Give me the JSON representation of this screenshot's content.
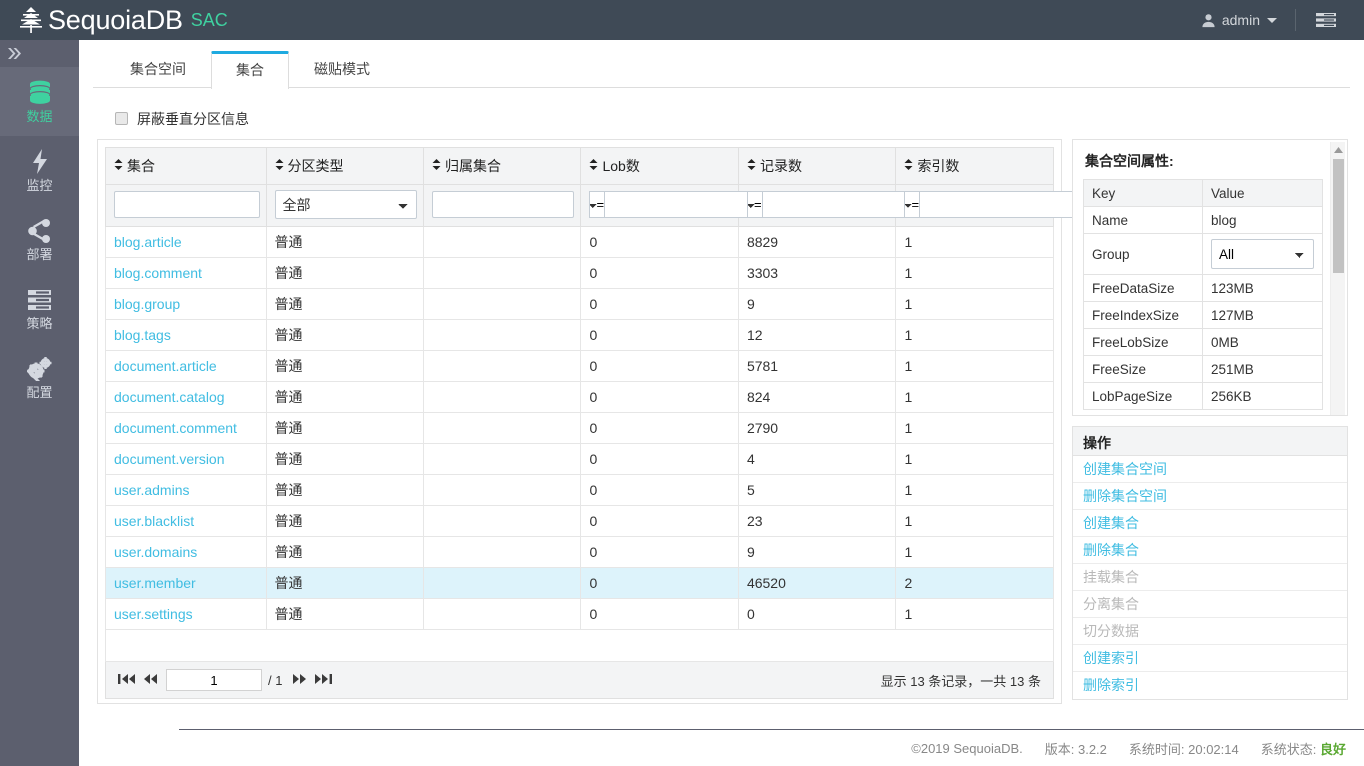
{
  "header": {
    "brand": "SequoiaDB",
    "brand_sub": "SAC",
    "logo_icon": "sequoia-tree-icon",
    "user_icon": "user-icon",
    "user_label": "admin",
    "caret_icon": "chevron-down-icon",
    "menu_icon": "hamburger-menu-icon"
  },
  "sidebar": {
    "collapse_icon": "double-chevron-right-icon",
    "items": [
      {
        "label": "数据",
        "icon": "database-icon",
        "active": true
      },
      {
        "label": "监控",
        "icon": "bolt-icon",
        "active": false
      },
      {
        "label": "部署",
        "icon": "share-nodes-icon",
        "active": false
      },
      {
        "label": "策略",
        "icon": "list-bars-icon",
        "active": false
      },
      {
        "label": "配置",
        "icon": "gears-icon",
        "active": false
      }
    ]
  },
  "tabs": [
    {
      "label": "集合空间",
      "active": false
    },
    {
      "label": "集合",
      "active": true
    },
    {
      "label": "磁贴模式",
      "active": false
    }
  ],
  "mask_option": {
    "label": "屏蔽垂直分区信息",
    "checked": false
  },
  "table": {
    "columns": [
      {
        "key": "collection",
        "label": "集合",
        "filter": "text",
        "value": "",
        "placeholder": ""
      },
      {
        "key": "partition_type",
        "label": "分区类型",
        "filter": "select",
        "value": "全部",
        "options": [
          "全部"
        ]
      },
      {
        "key": "owner",
        "label": "归属集合",
        "filter": "text",
        "value": "",
        "placeholder": ""
      },
      {
        "key": "lob_count",
        "label": "Lob数",
        "filter": "operator",
        "operator": "=",
        "value": "",
        "options": [
          "=",
          ">",
          "<"
        ]
      },
      {
        "key": "record_count",
        "label": "记录数",
        "filter": "operator",
        "operator": "=",
        "value": "",
        "options": [
          "=",
          ">",
          "<"
        ]
      },
      {
        "key": "index_count",
        "label": "索引数",
        "filter": "operator",
        "operator": "=",
        "value": "",
        "options": [
          "=",
          ">",
          "<"
        ]
      }
    ],
    "sort_icon": "sort-updown-icon",
    "rows": [
      {
        "collection": "blog.article",
        "partition_type": "普通",
        "owner": "",
        "lob_count": "0",
        "record_count": "8829",
        "index_count": "1",
        "selected": false
      },
      {
        "collection": "blog.comment",
        "partition_type": "普通",
        "owner": "",
        "lob_count": "0",
        "record_count": "3303",
        "index_count": "1",
        "selected": false
      },
      {
        "collection": "blog.group",
        "partition_type": "普通",
        "owner": "",
        "lob_count": "0",
        "record_count": "9",
        "index_count": "1",
        "selected": false
      },
      {
        "collection": "blog.tags",
        "partition_type": "普通",
        "owner": "",
        "lob_count": "0",
        "record_count": "12",
        "index_count": "1",
        "selected": false
      },
      {
        "collection": "document.article",
        "partition_type": "普通",
        "owner": "",
        "lob_count": "0",
        "record_count": "5781",
        "index_count": "1",
        "selected": false
      },
      {
        "collection": "document.catalog",
        "partition_type": "普通",
        "owner": "",
        "lob_count": "0",
        "record_count": "824",
        "index_count": "1",
        "selected": false
      },
      {
        "collection": "document.comment",
        "partition_type": "普通",
        "owner": "",
        "lob_count": "0",
        "record_count": "2790",
        "index_count": "1",
        "selected": false
      },
      {
        "collection": "document.version",
        "partition_type": "普通",
        "owner": "",
        "lob_count": "0",
        "record_count": "4",
        "index_count": "1",
        "selected": false
      },
      {
        "collection": "user.admins",
        "partition_type": "普通",
        "owner": "",
        "lob_count": "0",
        "record_count": "5",
        "index_count": "1",
        "selected": false
      },
      {
        "collection": "user.blacklist",
        "partition_type": "普通",
        "owner": "",
        "lob_count": "0",
        "record_count": "23",
        "index_count": "1",
        "selected": false
      },
      {
        "collection": "user.domains",
        "partition_type": "普通",
        "owner": "",
        "lob_count": "0",
        "record_count": "9",
        "index_count": "1",
        "selected": false
      },
      {
        "collection": "user.member",
        "partition_type": "普通",
        "owner": "",
        "lob_count": "0",
        "record_count": "46520",
        "index_count": "2",
        "selected": true
      },
      {
        "collection": "user.settings",
        "partition_type": "普通",
        "owner": "",
        "lob_count": "0",
        "record_count": "0",
        "index_count": "1",
        "selected": false
      }
    ]
  },
  "pagination": {
    "first_icon": "first-page-icon",
    "prev_icon": "prev-page-icon",
    "next_icon": "next-page-icon",
    "last_icon": "last-page-icon",
    "current_page": "1",
    "total_pages": "/ 1",
    "info": "显示 13 条记录，一共 13 条"
  },
  "properties": {
    "title": "集合空间属性:",
    "key_header": "Key",
    "value_header": "Value",
    "rows": [
      {
        "key": "Name",
        "value": "blog",
        "type": "text"
      },
      {
        "key": "Group",
        "value": "All",
        "type": "select",
        "options": [
          "All"
        ]
      },
      {
        "key": "FreeDataSize",
        "value": "123MB",
        "type": "text"
      },
      {
        "key": "FreeIndexSize",
        "value": "127MB",
        "type": "text"
      },
      {
        "key": "FreeLobSize",
        "value": "0MB",
        "type": "text"
      },
      {
        "key": "FreeSize",
        "value": "251MB",
        "type": "text"
      },
      {
        "key": "LobPageSize",
        "value": "256KB",
        "type": "text"
      }
    ],
    "scroll_up_icon": "scroll-up-arrow-icon",
    "scroll_down_icon": "scroll-down-arrow-icon"
  },
  "operations": {
    "title": "操作",
    "items": [
      {
        "label": "创建集合空间",
        "disabled": false
      },
      {
        "label": "删除集合空间",
        "disabled": false
      },
      {
        "label": "创建集合",
        "disabled": false
      },
      {
        "label": "删除集合",
        "disabled": false
      },
      {
        "label": "挂载集合",
        "disabled": true
      },
      {
        "label": "分离集合",
        "disabled": true
      },
      {
        "label": "切分数据",
        "disabled": true
      },
      {
        "label": "创建索引",
        "disabled": false
      },
      {
        "label": "删除索引",
        "disabled": false
      }
    ]
  },
  "footer": {
    "copyright": "©2019 SequoiaDB.",
    "version": "版本: 3.2.2",
    "time": "系统时间: 20:02:14",
    "status_label": "系统状态:",
    "status_value": "良好",
    "status_color": "#5aa832"
  }
}
